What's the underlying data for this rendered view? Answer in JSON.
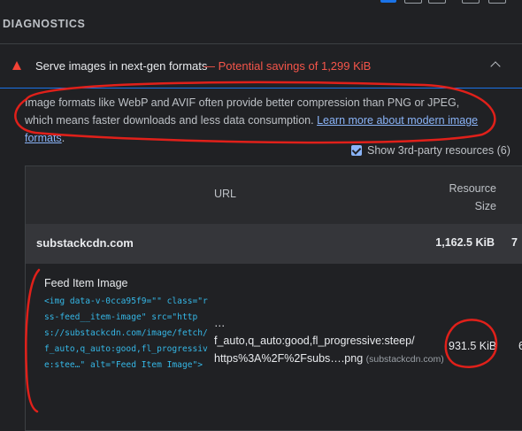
{
  "section_title": "DIAGNOSTICS",
  "audit": {
    "title": "Serve images in next-gen formats",
    "savings": "— Potential savings of 1,299 KiB",
    "description_text": "Image formats like WebP and AVIF often provide better compression than PNG or JPEG, which means faster downloads and less data consumption. ",
    "learn_more_link": "Learn more about modern image formats",
    "description_suffix": ".",
    "third_party_label": "Show 3rd-party resources (6)",
    "third_party_checked": true
  },
  "table": {
    "columns": {
      "url": "URL",
      "resource_size_line1": "Resource",
      "resource_size_line2": "Size"
    },
    "group": {
      "name": "substackcdn.com",
      "size": "1,162.5 KiB",
      "extra": "7"
    },
    "item": {
      "title": "Feed Item Image",
      "code": "<img data-v-0cca95f9=\"\" class=\"rss-feed__item-image\" src=\"https://substackcdn.com/image/fetch/f_auto,q_auto:good,fl_progressive:stee…\" alt=\"Feed Item Image\">",
      "url_line1": "…",
      "url_line2": "f_auto,q_auto:good,fl_progressive:steep/",
      "url_line3": "https%3A%2F%2Fsubs….png",
      "url_host": "(substackcdn.com)",
      "size": "931.5 KiB",
      "extra": "6"
    }
  },
  "colors": {
    "accent": "#1a73e8",
    "fail": "#f44336",
    "savings": "#f5554a",
    "link": "#8ab4f8",
    "annotation": "#e0201a"
  }
}
